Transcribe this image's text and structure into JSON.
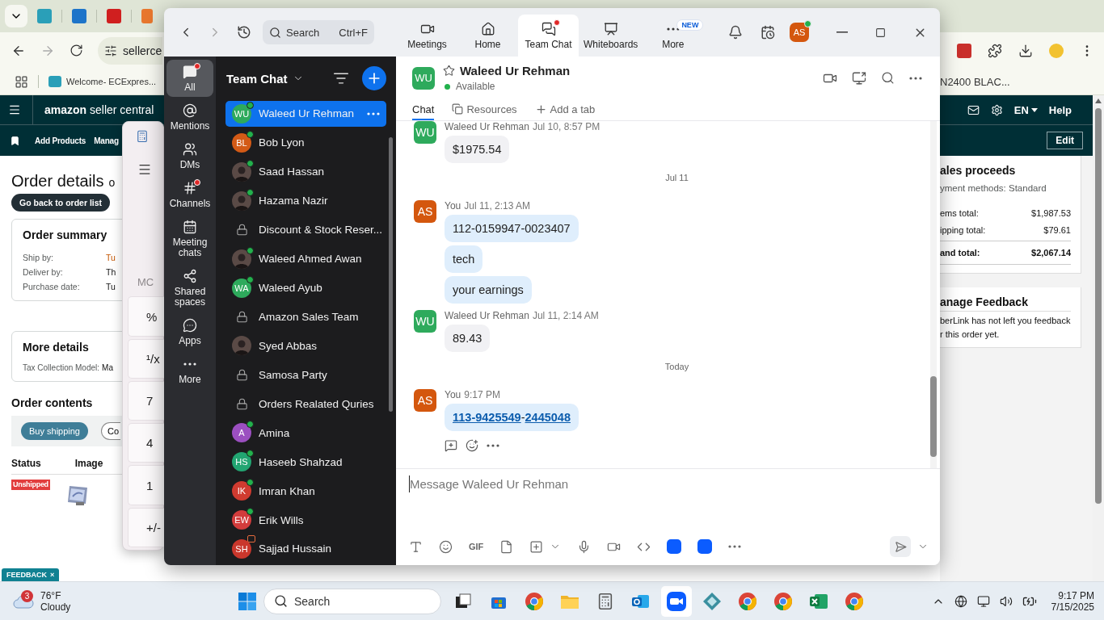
{
  "browser": {
    "address": "sellerce",
    "bookmark": "Welcome- ECExpres...",
    "bookmark_right": "N2400 BLAC..."
  },
  "amazon": {
    "logo": "**amazon** seller central",
    "language": "EN",
    "help": "Help",
    "nav": [
      "Add Products",
      "Manag"
    ],
    "edit": "Edit",
    "title": "Order details",
    "title_tail": "o",
    "back": "Go back to order list",
    "summary": {
      "title": "Order summary",
      "rows": [
        {
          "label": "Ship by:",
          "value": "Tu",
          "urgent": true
        },
        {
          "label": "Deliver by:",
          "value": "Th",
          "urgent": false
        },
        {
          "label": "Purchase date:",
          "value": "Tu",
          "urgent": false
        }
      ]
    },
    "more": {
      "title": "More details",
      "label": "Tax Collection Model:",
      "value": "Ma"
    },
    "contents": {
      "title": "Order contents",
      "buy": "Buy shipping",
      "second": "Co",
      "columns": [
        "Status",
        "Image"
      ],
      "status": "Unshipped"
    },
    "feedback": "FEEDBACK",
    "feedback_close": "×",
    "proceeds": {
      "title": "ales proceeds",
      "methods": "yment methods: Standard",
      "rows": [
        {
          "label": "ems total:",
          "value": "$1,987.53",
          "total": false
        },
        {
          "label": "ipping total:",
          "value": "$79.61",
          "total": false
        },
        {
          "label": "and total:",
          "value": "$2,067.14",
          "total": true
        }
      ]
    },
    "manage": {
      "title": "anage Feedback",
      "lines": [
        "berLink has not left you feedback",
        "r this order yet."
      ]
    }
  },
  "calculator": {
    "memory": "MC",
    "keys": [
      "%",
      "¹/x",
      "7",
      "4",
      "1",
      "+/-"
    ]
  },
  "zoom": {
    "search": {
      "placeholder": "Search",
      "shortcut": "Ctrl+F"
    },
    "tabs": [
      {
        "label": "Meetings",
        "selected": false,
        "badge": false
      },
      {
        "label": "Home",
        "selected": false,
        "badge": false
      },
      {
        "label": "Team Chat",
        "selected": true,
        "badge": true
      },
      {
        "label": "Whiteboards",
        "selected": false,
        "badge": false
      },
      {
        "label": "More",
        "selected": false,
        "badge": false,
        "tag": "NEW"
      }
    ],
    "user": {
      "initials": "AS",
      "color": "#d4570e",
      "online": true
    },
    "rail": [
      {
        "label": "All",
        "selected": true,
        "badge": true
      },
      {
        "label": "Mentions",
        "selected": false,
        "badge": false
      },
      {
        "label": "DMs",
        "selected": false,
        "badge": false
      },
      {
        "label": "Channels",
        "selected": false,
        "badge": true
      },
      {
        "label": "Meeting chats",
        "selected": false,
        "badge": false
      },
      {
        "label": "Shared spaces",
        "selected": false,
        "badge": false
      },
      {
        "label": "Apps",
        "selected": false,
        "badge": false
      },
      {
        "label": "More",
        "selected": false,
        "badge": false
      }
    ],
    "list_title": "Team Chat",
    "chats": [
      {
        "kind": "initials",
        "initials": "WU",
        "color": "#2eaa5c",
        "name": "Waleed Ur Rehman",
        "online": true,
        "meeting": false,
        "selected": true
      },
      {
        "kind": "initials",
        "initials": "BL",
        "color": "#d35a16",
        "name": "Bob Lyon",
        "online": true,
        "meeting": false,
        "selected": false
      },
      {
        "name": "Saad Hassan",
        "online": true,
        "meeting": false,
        "selected": false
      },
      {
        "name": "Hazama Nazir",
        "online": true,
        "meeting": false,
        "selected": false
      },
      {
        "kind": "channel",
        "name": "Discount & Stock Reser...",
        "online": false,
        "meeting": false,
        "selected": false
      },
      {
        "name": "Waleed Ahmed Awan",
        "online": true,
        "meeting": false,
        "selected": false
      },
      {
        "kind": "initials",
        "initials": "WA",
        "color": "#2eaa5c",
        "name": "Waleed Ayub",
        "online": true,
        "meeting": false,
        "selected": false
      },
      {
        "kind": "channel",
        "name": "Amazon Sales Team",
        "online": false,
        "meeting": false,
        "selected": false
      },
      {
        "name": "Syed Abbas",
        "online": false,
        "meeting": false,
        "selected": false
      },
      {
        "kind": "channel",
        "name": "Samosa Party",
        "online": false,
        "meeting": false,
        "selected": false
      },
      {
        "kind": "channel",
        "name": "Orders Realated Quries",
        "online": false,
        "meeting": false,
        "selected": false
      },
      {
        "kind": "initials",
        "initials": "A",
        "color": "#9b4fc0",
        "name": "Amina",
        "online": true,
        "meeting": false,
        "selected": false
      },
      {
        "kind": "initials",
        "initials": "HS",
        "color": "#22a572",
        "name": "Haseeb Shahzad",
        "online": true,
        "meeting": false,
        "selected": false
      },
      {
        "kind": "initials",
        "initials": "IK",
        "color": "#d03b30",
        "name": "Imran Khan",
        "online": true,
        "meeting": false,
        "selected": false
      },
      {
        "kind": "initials",
        "initials": "EW",
        "color": "#d23c3c",
        "name": "Erik Wills",
        "online": true,
        "meeting": false,
        "selected": false
      },
      {
        "kind": "initials",
        "initials": "SH",
        "color": "#c9372c",
        "name": "Sajjad Hussain",
        "online": false,
        "meeting": true,
        "selected": false
      }
    ],
    "conversation": {
      "initials": "WU",
      "color": "#2eaa5c",
      "name": "Waleed Ur Rehman",
      "status": "Available",
      "online": true,
      "tabs": [
        {
          "label": "Chat",
          "selected": true
        },
        {
          "label": "Resources",
          "selected": false
        },
        {
          "label": "Add a tab",
          "selected": false
        }
      ],
      "messages": [
        {
          "kind": "message",
          "sender": "Waleed Ur Rehman",
          "time": "Jul 10, 8:57 PM",
          "initials": "WU",
          "color": "#2eaa5c",
          "mine": false,
          "actions": false,
          "bubbles": [
            {
              "parts": [
                {
                  "text": "$1975.54",
                  "link": false
                }
              ]
            }
          ]
        },
        {
          "kind": "divider",
          "text": "Jul 11"
        },
        {
          "kind": "message",
          "sender": "You",
          "time": "Jul 11, 2:13 AM",
          "initials": "AS",
          "color": "#d4570e",
          "mine": true,
          "actions": false,
          "bubbles": [
            {
              "parts": [
                {
                  "text": "112-0159947-0023407",
                  "link": false
                }
              ]
            },
            {
              "parts": [
                {
                  "text": "tech",
                  "link": false
                }
              ]
            },
            {
              "parts": [
                {
                  "text": "your earnings",
                  "link": false
                }
              ]
            }
          ]
        },
        {
          "kind": "message",
          "sender": "Waleed Ur Rehman",
          "time": "Jul 11, 2:14 AM",
          "initials": "WU",
          "color": "#2eaa5c",
          "mine": false,
          "actions": false,
          "bubbles": [
            {
              "parts": [
                {
                  "text": "89.43",
                  "link": false
                }
              ]
            }
          ]
        },
        {
          "kind": "divider",
          "text": "Today"
        },
        {
          "kind": "message",
          "sender": "You",
          "time": "9:17 PM",
          "initials": "AS",
          "color": "#d4570e",
          "mine": true,
          "actions": true,
          "bubbles": [
            {
              "parts": [
                {
                  "text": "113-9425549",
                  "link": true
                },
                {
                  "text": "-",
                  "link": false
                },
                {
                  "text": "2445048",
                  "link": true
                }
              ]
            }
          ]
        }
      ],
      "placeholder": "Message Waleed Ur Rehman",
      "gif": "GIF"
    }
  },
  "taskbar": {
    "weather_badge": "3",
    "temperature": "76°F",
    "condition": "Cloudy",
    "search": "Search",
    "time": "9:17 PM",
    "date": "7/15/2025"
  }
}
